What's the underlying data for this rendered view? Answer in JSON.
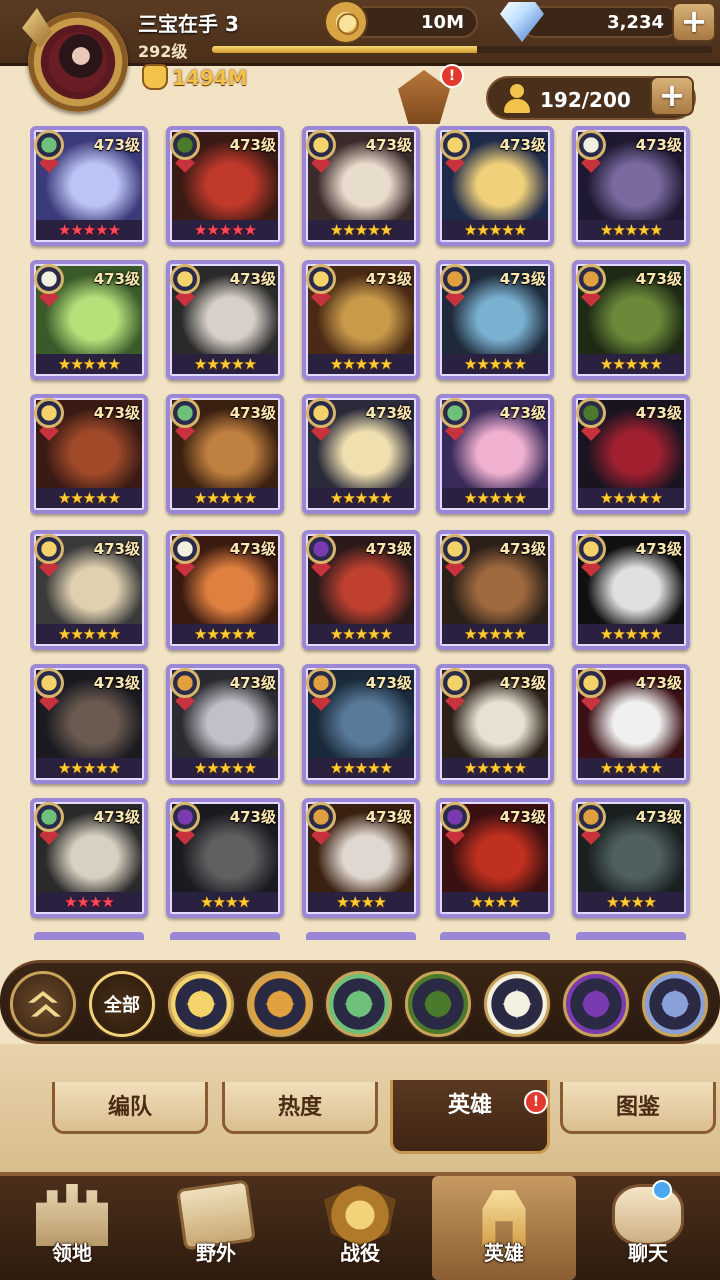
{
  "player": {
    "name": "三宝在手 3",
    "level": "292级",
    "power": "1494M",
    "xp_progress_percent": 53
  },
  "currency": {
    "gold": "10M",
    "diamonds": "3,234"
  },
  "hero_capacity": "192/200",
  "alert_mark": "!",
  "heroes": [
    {
      "level": "473级",
      "stars": "★★★★★",
      "star_color": "red",
      "faction": "wilder",
      "colors": [
        "#3b3a7a",
        "#bcc4f5"
      ]
    },
    {
      "level": "473级",
      "stars": "★★★★★",
      "star_color": "red",
      "faction": "graveborn",
      "colors": [
        "#3a1a14",
        "#c0392b"
      ]
    },
    {
      "level": "473级",
      "stars": "★★★★★",
      "star_color": "gold",
      "faction": "lightbearer",
      "colors": [
        "#3a2a2a",
        "#e8dccc"
      ]
    },
    {
      "level": "473级",
      "stars": "★★★★★",
      "star_color": "gold",
      "faction": "lightbearer",
      "colors": [
        "#1e2a4a",
        "#f0d07a"
      ]
    },
    {
      "level": "473级",
      "stars": "★★★★★",
      "star_color": "gold",
      "faction": "celestial",
      "colors": [
        "#1e1830",
        "#7a6aa0"
      ]
    },
    {
      "level": "473级",
      "stars": "★★★★★",
      "star_color": "gold",
      "faction": "celestial",
      "colors": [
        "#3a5a2a",
        "#b6e07a"
      ]
    },
    {
      "level": "473级",
      "stars": "★★★★★",
      "star_color": "gold",
      "faction": "lightbearer",
      "colors": [
        "#2a2a2a",
        "#d8d0c8"
      ]
    },
    {
      "level": "473级",
      "stars": "★★★★★",
      "star_color": "gold",
      "faction": "lightbearer",
      "colors": [
        "#4a2a14",
        "#c89a4a"
      ]
    },
    {
      "level": "473级",
      "stars": "★★★★★",
      "star_color": "gold",
      "faction": "mauler",
      "colors": [
        "#1e2a3a",
        "#7ab0d0"
      ]
    },
    {
      "level": "473级",
      "stars": "★★★★★",
      "star_color": "gold",
      "faction": "mauler",
      "colors": [
        "#1e2a14",
        "#6a8a3a"
      ]
    },
    {
      "level": "473级",
      "stars": "★★★★★",
      "star_color": "gold",
      "faction": "lightbearer",
      "colors": [
        "#3a1a14",
        "#a04a2a"
      ]
    },
    {
      "level": "473级",
      "stars": "★★★★★",
      "star_color": "gold",
      "faction": "wilder",
      "colors": [
        "#3a2010",
        "#c08040"
      ]
    },
    {
      "level": "473级",
      "stars": "★★★★★",
      "star_color": "gold",
      "faction": "lightbearer",
      "colors": [
        "#2a2a3a",
        "#f0e0b0"
      ]
    },
    {
      "level": "473级",
      "stars": "★★★★★",
      "star_color": "gold",
      "faction": "wilder",
      "colors": [
        "#3a2a5a",
        "#f0b0d0"
      ]
    },
    {
      "level": "473级",
      "stars": "★★★★★",
      "star_color": "gold",
      "faction": "graveborn",
      "colors": [
        "#1a1420",
        "#a02030"
      ]
    },
    {
      "level": "473级",
      "stars": "★★★★★",
      "star_color": "gold",
      "faction": "lightbearer",
      "colors": [
        "#3a3a3a",
        "#e0d0b0"
      ]
    },
    {
      "level": "473级",
      "stars": "★★★★★",
      "star_color": "gold",
      "faction": "celestial",
      "colors": [
        "#3a1a10",
        "#e08040"
      ]
    },
    {
      "level": "473级",
      "stars": "★★★★★",
      "star_color": "gold",
      "faction": "hypogean",
      "colors": [
        "#2a1a1a",
        "#c04030"
      ]
    },
    {
      "level": "473级",
      "stars": "★★★★★",
      "star_color": "gold",
      "faction": "lightbearer",
      "colors": [
        "#2a2018",
        "#a06a40"
      ]
    },
    {
      "level": "473级",
      "stars": "★★★★★",
      "star_color": "gold",
      "faction": "lightbearer",
      "colors": [
        "#101010",
        "#e0e0e0"
      ]
    },
    {
      "level": "473级",
      "stars": "★★★★★",
      "star_color": "gold",
      "faction": "lightbearer",
      "colors": [
        "#1a1a20",
        "#6a5a50"
      ]
    },
    {
      "level": "473级",
      "stars": "★★★★★",
      "star_color": "gold",
      "faction": "mauler",
      "colors": [
        "#2a2a30",
        "#c0c0c8"
      ]
    },
    {
      "level": "473级",
      "stars": "★★★★★",
      "star_color": "gold",
      "faction": "mauler",
      "colors": [
        "#1a2a3a",
        "#5a7a9a"
      ]
    },
    {
      "level": "473级",
      "stars": "★★★★★",
      "star_color": "gold",
      "faction": "lightbearer",
      "colors": [
        "#2a2018",
        "#e8e0d0"
      ]
    },
    {
      "level": "473级",
      "stars": "★★★★★",
      "star_color": "gold",
      "faction": "lightbearer",
      "colors": [
        "#3a1014",
        "#f0f0f0"
      ]
    },
    {
      "level": "473级",
      "stars": "★★★★",
      "star_color": "red",
      "faction": "wilder",
      "colors": [
        "#2a2a2a",
        "#d8d0c0"
      ]
    },
    {
      "level": "473级",
      "stars": "★★★★",
      "star_color": "gold",
      "faction": "hypogean",
      "colors": [
        "#1a1a20",
        "#606060"
      ]
    },
    {
      "level": "473级",
      "stars": "★★★★",
      "star_color": "gold",
      "faction": "mauler",
      "colors": [
        "#3a2010",
        "#e0d8d0"
      ]
    },
    {
      "level": "473级",
      "stars": "★★★★",
      "star_color": "gold",
      "faction": "hypogean",
      "colors": [
        "#3a1010",
        "#c03020"
      ]
    },
    {
      "level": "473级",
      "stars": "★★★★",
      "star_color": "gold",
      "faction": "mauler",
      "colors": [
        "#1a2020",
        "#506060"
      ]
    }
  ],
  "filters": [
    {
      "key": "collapse",
      "label": ""
    },
    {
      "key": "all",
      "label": "全部"
    },
    {
      "key": "lightbearer",
      "label": ""
    },
    {
      "key": "mauler",
      "label": ""
    },
    {
      "key": "wilder",
      "label": ""
    },
    {
      "key": "graveborn",
      "label": ""
    },
    {
      "key": "celestial",
      "label": ""
    },
    {
      "key": "hypogean",
      "label": ""
    },
    {
      "key": "dimensional",
      "label": ""
    }
  ],
  "tabs": {
    "formation": "编队",
    "heat": "热度",
    "heroes": "英雄",
    "codex": "图鉴"
  },
  "nav": {
    "territory": "领地",
    "wilderness": "野外",
    "battle": "战役",
    "heroes": "英雄",
    "chat": "聊天"
  },
  "faction_colors": {
    "lightbearer": "#f3d36a",
    "mauler": "#e0a040",
    "wilder": "#6fc07a",
    "graveborn": "#4a7a2a",
    "celestial": "#f4f0e0",
    "hypogean": "#7a3ab0",
    "dimensional": "#8aa0d8"
  }
}
